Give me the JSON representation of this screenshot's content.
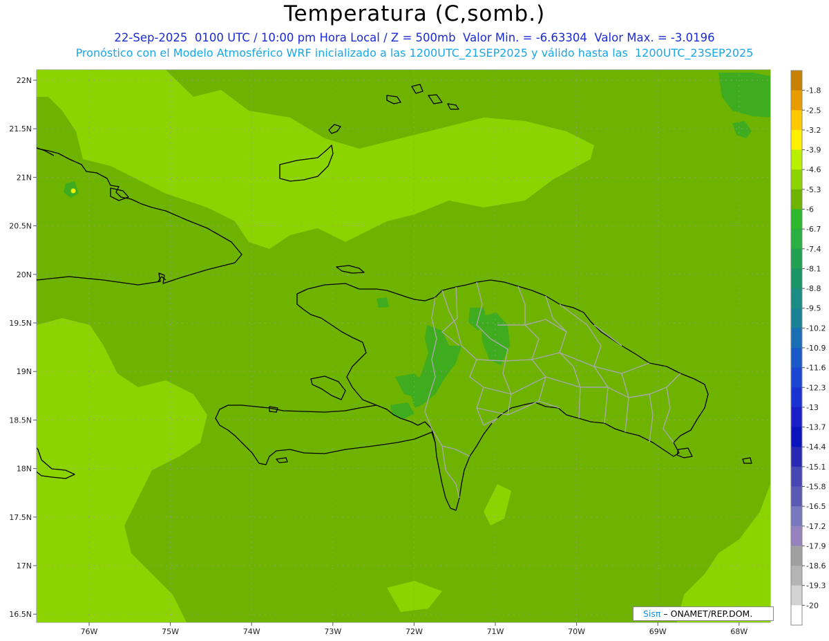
{
  "header": {
    "title": "Temperatura (C,somb.)",
    "subtitle_1": "22-Sep-2025  0100 UTC / 10:00 pm Hora Local / Z = 500mb  Valor Min. = -6.63304  Valor Max. = -3.0196",
    "subtitle_2": "Pronóstico con el Modelo Atmosférico WRF inicializado a las 1200UTC_21SEP2025 y válido hasta las  1200UTC_23SEP2025"
  },
  "map": {
    "lat_labels": [
      "22N",
      "21.5N",
      "21N",
      "20.5N",
      "20N",
      "19.5N",
      "19N",
      "18.5N",
      "18N",
      "17.5N",
      "17N",
      "16.5N"
    ],
    "lon_labels": [
      "76W",
      "75W",
      "74W",
      "73W",
      "72W",
      "71W",
      "70W",
      "69W",
      "68W"
    ],
    "field_colors": {
      "base": "#6db300",
      "light": "#8cd400",
      "dark": "#3fac20",
      "yellow": "#f0f000"
    }
  },
  "colorbar": {
    "labels": [
      "-1.8",
      "-2.5",
      "-3.2",
      "-3.9",
      "-4.6",
      "-5.3",
      "-6",
      "-6.7",
      "-7.4",
      "-8.1",
      "-8.8",
      "-9.5",
      "-10.2",
      "-10.9",
      "-11.6",
      "-12.3",
      "-13",
      "-13.7",
      "-14.4",
      "-15.1",
      "-15.8",
      "-16.5",
      "-17.2",
      "-17.9",
      "-18.6",
      "-19.3",
      "-20"
    ],
    "colors": [
      "#c88000",
      "#e89c00",
      "#ffc800",
      "#fff000",
      "#b8f000",
      "#8cd400",
      "#6db300",
      "#2db82d",
      "#28b040",
      "#20a050",
      "#1a9666",
      "#1a8c84",
      "#1a8296",
      "#1a6eb4",
      "#1a5ac8",
      "#1a46d2",
      "#1a32d2",
      "#1a1ec8",
      "#0a14be",
      "#2828b4",
      "#4646b4",
      "#5a5ab4",
      "#7878be",
      "#9682be",
      "#a0a0a0",
      "#b4b4b4",
      "#d2d2d2",
      "#ffffff"
    ]
  },
  "credit": {
    "brand": "Sisπ",
    "text": " – ONAMET/REP.DOM."
  }
}
